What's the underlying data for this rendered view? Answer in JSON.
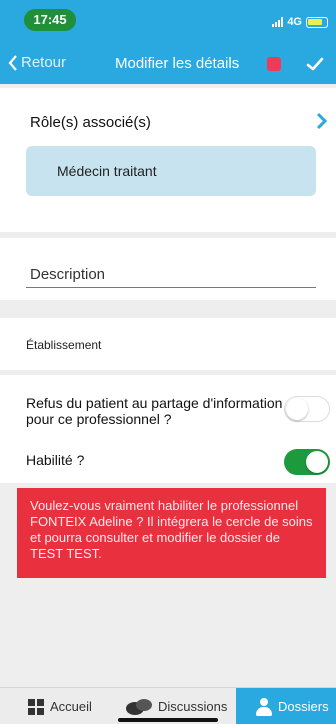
{
  "status_bar": {
    "time": "17:45",
    "network": "4G",
    "accent_color": "#2aa9e0"
  },
  "nav": {
    "back_label": "Retour",
    "title": "Modifier les détails"
  },
  "roles": {
    "title": "Rôle(s) associé(s)",
    "chip_label": "Médecin traitant"
  },
  "description": {
    "label": "Description"
  },
  "etablissement": {
    "label": "Établissement"
  },
  "toggles": {
    "refus_label": "Refus du patient au partage d'information pour ce professionnel ?",
    "refus_state": "off",
    "habilite_label": "Habilité ?",
    "habilite_state": "on"
  },
  "warning": {
    "text": "Voulez-vous vraiment habiliter le professionnel FONTEIX Adeline ? Il intégrera le cercle de soins et pourra consulter et modifier le dossier de TEST TEST.",
    "color": "#e8303e"
  },
  "tab_bar": {
    "items": [
      {
        "label": "Accueil",
        "icon": "grid-icon",
        "active": false
      },
      {
        "label": "Discussions",
        "icon": "chat-bubbles-icon",
        "active": false
      },
      {
        "label": "Dossiers",
        "icon": "person-icon",
        "active": true
      }
    ]
  }
}
